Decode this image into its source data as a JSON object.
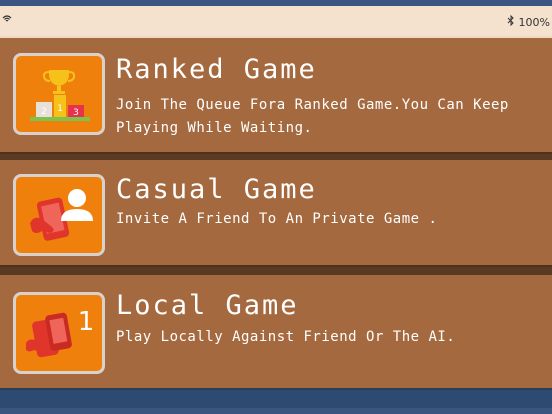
{
  "status_bar": {
    "battery": "100%"
  },
  "menu": {
    "items": [
      {
        "title": "Ranked Game",
        "description": "Join The Queue Fora Ranked Game.You Can Keep Playing While Waiting.",
        "icon": "trophy-podium-icon"
      },
      {
        "title": "Casual Game",
        "description": "Invite A Friend To An Private Game .",
        "icon": "invite-friend-phone-icon"
      },
      {
        "title": "Local Game",
        "description": "Play Locally Against Friend Or The AI.",
        "icon": "local-phones-icon",
        "badge": "1"
      }
    ]
  },
  "podium": {
    "left": "2",
    "center": "1",
    "right": "3"
  },
  "colors": {
    "card": "#a5693f",
    "icon_bg": "#f0800c",
    "phone_red": "#e0352b",
    "background": "#efd9c4"
  }
}
